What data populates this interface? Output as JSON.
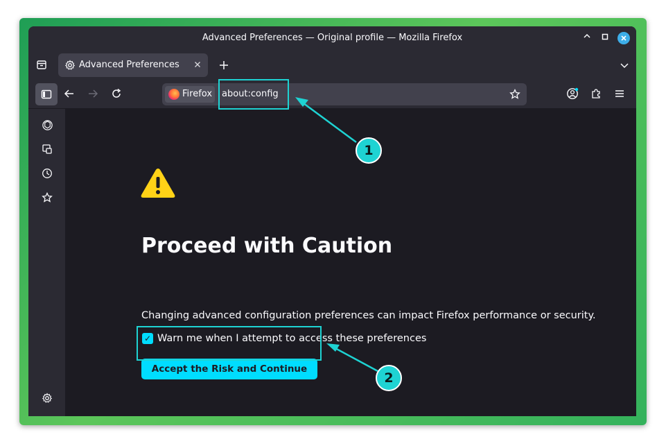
{
  "window": {
    "title": "Advanced Preferences — Original profile — Mozilla Firefox"
  },
  "tabs": [
    {
      "label": "Advanced Preferences"
    }
  ],
  "urlbar": {
    "identity_label": "Firefox",
    "url": "about:config"
  },
  "page": {
    "heading": "Proceed with Caution",
    "description": "Changing advanced configuration preferences can impact Firefox performance or security.",
    "checkbox_label": "Warn me when I attempt to access these preferences",
    "checkbox_checked": true,
    "accept_button": "Accept the Risk and Continue"
  },
  "annotations": [
    {
      "label": "1"
    },
    {
      "label": "2"
    }
  ],
  "sidebar": {
    "icons": [
      "chatbot-icon",
      "synced-tabs-icon",
      "history-icon",
      "bookmarks-icon"
    ],
    "bottom_icon": "settings-icon"
  },
  "colors": {
    "accent": "#00ddff",
    "annotation": "#1ed3d3",
    "page_background": "#1c1b22",
    "chrome_background": "#2b2a33",
    "warning": "#ffd217"
  }
}
